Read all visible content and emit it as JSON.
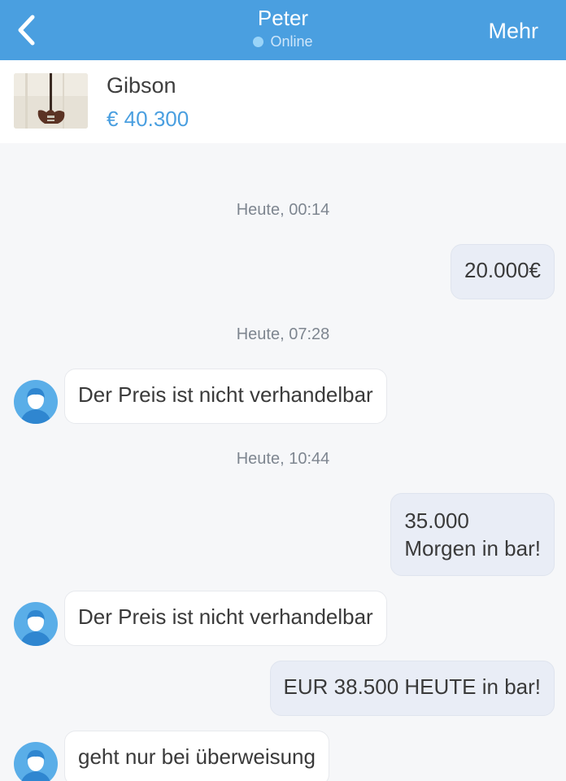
{
  "header": {
    "back_icon": "chevron-left-icon",
    "title": "Peter",
    "status": "Online",
    "more_label": "Mehr",
    "colors": {
      "bar": "#4a9fe0",
      "status_dot": "#9ad4f8"
    }
  },
  "product": {
    "name": "Gibson",
    "price": "€ 40.300"
  },
  "chat": {
    "stamps": [
      "Heute, 00:14",
      "Heute, 07:28",
      "Heute, 10:44"
    ],
    "messages": [
      {
        "direction": "out",
        "text": "20.000€"
      },
      {
        "direction": "in",
        "text": "Der Preis ist nicht verhandelbar"
      },
      {
        "direction": "out",
        "line1": "35.000",
        "line2": "Morgen in bar!"
      },
      {
        "direction": "in",
        "text": "Der Preis ist nicht verhandelbar"
      },
      {
        "direction": "out",
        "text": "EUR 38.500 HEUTE in bar!"
      },
      {
        "direction": "in",
        "text": "geht nur bei überweisung"
      }
    ]
  }
}
